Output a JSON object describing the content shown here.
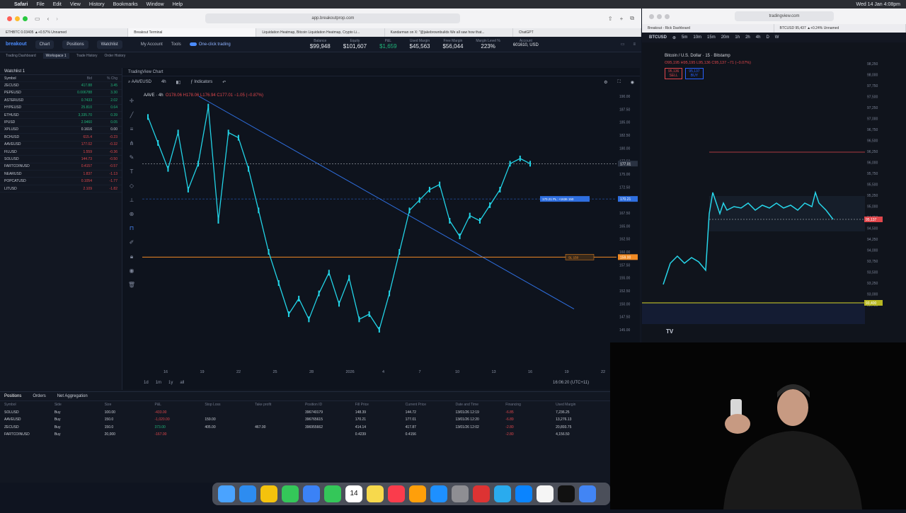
{
  "menubar": {
    "apple": "",
    "items": [
      "Safari",
      "File",
      "Edit",
      "View",
      "History",
      "Bookmarks",
      "Window",
      "Help"
    ],
    "clock": "Wed 14 Jan 4:08pm"
  },
  "left_browser": {
    "url": "app.breakoutprop.com",
    "tabs": [
      "ETHBTC 0.03405 ▲+0.57% Unnamed",
      "Breakout Terminal",
      "Liquidation Heatmap, Bitcoin Liquidation Heatmap, Crypto Li...",
      "Kandarman on X: \"@jakebrownbuilds We all saw how that...",
      "ChatGPT"
    ]
  },
  "app": {
    "logo": "breakout",
    "nav": [
      "Chart",
      "Positions",
      "Watchlist"
    ],
    "account_btn": "My Account",
    "tools_btn": "Tools",
    "one_click": "One-click trading",
    "metrics": [
      {
        "label": "Balance",
        "value": "$99,948"
      },
      {
        "label": "Equity",
        "value": "$101,607"
      },
      {
        "label": "P&L",
        "value": "$1,659"
      },
      {
        "label": "Used Margin",
        "value": "$45,563"
      },
      {
        "label": "Free Margin",
        "value": "$56,044"
      },
      {
        "label": "Margin Level %",
        "value": "223%"
      },
      {
        "label": "Account",
        "value": "601610, USD"
      }
    ],
    "subnav": [
      "Trading Dashboard",
      "Workspace 1",
      "Trade History",
      "Order History"
    ]
  },
  "watchlist": {
    "title": "Watchlist 1",
    "columns": [
      "Symbol",
      "Bid",
      "% Chg"
    ],
    "rows": [
      {
        "sym": "ZECUSD",
        "bid": "417.88",
        "chg": "3.45",
        "dir": "pos"
      },
      {
        "sym": "PEPEUSD",
        "bid": "0.006788",
        "chg": "3.30",
        "dir": "pos"
      },
      {
        "sym": "ASTERUSD",
        "bid": "0.7433",
        "chg": "2.02",
        "dir": "pos"
      },
      {
        "sym": "HYPEUSD",
        "bid": "25.810",
        "chg": "0.64",
        "dir": "pos"
      },
      {
        "sym": "ETHUSD",
        "bid": "3,335.70",
        "chg": "0.39",
        "dir": "pos"
      },
      {
        "sym": "IPUSD",
        "bid": "2.9460",
        "chg": "0.05",
        "dir": "pos"
      },
      {
        "sym": "XPLUSD",
        "bid": "0.1616",
        "chg": "0.00",
        "dir": "neutral"
      },
      {
        "sym": "BCHUSD",
        "bid": "615.4",
        "chg": "-0.23",
        "dir": "neg"
      },
      {
        "sym": "AAVEUSD",
        "bid": "177.02",
        "chg": "-0.32",
        "dir": "neg"
      },
      {
        "sym": "FILUSD",
        "bid": "1.559",
        "chg": "-0.36",
        "dir": "neg"
      },
      {
        "sym": "SOLUSD",
        "bid": "144.73",
        "chg": "-0.50",
        "dir": "neg"
      },
      {
        "sym": "FARTCOINUSD",
        "bid": "0.4157",
        "chg": "-0.57",
        "dir": "neg"
      },
      {
        "sym": "NEARUSD",
        "bid": "1.837",
        "chg": "-1.13",
        "dir": "neg"
      },
      {
        "sym": "POPCATUSD",
        "bid": "0.1054",
        "chg": "-1.77",
        "dir": "neg"
      },
      {
        "sym": "LITUSD",
        "bid": "2.109",
        "chg": "-1.82",
        "dir": "neg"
      }
    ]
  },
  "chart": {
    "panel_title": "TradingView Chart",
    "symbol": "AAVEUSD",
    "timeframe": "4h",
    "indicators_btn": "Indicators",
    "ohlc_prefix": "AAVE · 4h",
    "ohlc": "O178.06 H178.06 L176.94 C177.01 −1.05 (−0.87%)",
    "x_labels": [
      "16",
      "19",
      "22",
      "25",
      "28",
      "2026",
      "4",
      "7",
      "10",
      "13",
      "16",
      "19",
      "22"
    ],
    "y_labels": [
      "190.00",
      "187.50",
      "185.00",
      "182.50",
      "180.00",
      "177.50",
      "175.00",
      "172.50",
      "170.00",
      "167.50",
      "165.00",
      "162.50",
      "160.00",
      "157.50",
      "155.00",
      "152.50",
      "150.00",
      "147.50",
      "145.00"
    ],
    "current_price_tag": "177.01",
    "order_tag": "170.21",
    "order_label": "170.21 PL: +1636 150",
    "sl_label": "SL 150",
    "sl_price_tag": "159.00",
    "time_buttons": [
      "1d",
      "1m",
      "1y",
      "all"
    ],
    "clock": "16:06:20 (UTC+11)"
  },
  "chart_data": {
    "type": "line",
    "title": "AAVEUSD 4h",
    "ylim": [
      145,
      190
    ],
    "series": [
      {
        "name": "AAVEUSD",
        "values": [
          186,
          181,
          176,
          183,
          172,
          177,
          188,
          166,
          183,
          182,
          176,
          168,
          160,
          154,
          148,
          151,
          147,
          152,
          156,
          150,
          155,
          147,
          148,
          145,
          152,
          160,
          168,
          170,
          172,
          173,
          166,
          163,
          167,
          166,
          169,
          172,
          177,
          178,
          177
        ]
      }
    ]
  },
  "positions": {
    "tabs": [
      "Positions",
      "Orders",
      "Net Aggregation"
    ],
    "columns": [
      "Symbol",
      "Side",
      "Size",
      "P&L",
      "Stop Loss",
      "Take profit",
      "Position ID",
      "Fill Price",
      "Current Price",
      "Date and Time",
      "Financing",
      "Used Margin"
    ],
    "rows": [
      [
        "SOLUSD",
        "Buy",
        "100.00",
        "-433.00",
        "",
        "",
        "396740179",
        "148.39",
        "144.72",
        "13/01/26 12:19",
        "-6.85",
        "7,236.25"
      ],
      [
        "AAVEUSD",
        "Buy",
        "150.0",
        "-1,020.00",
        "159.00",
        "",
        "396765615",
        "170.21",
        "177.01",
        "13/01/26 12:20",
        "-6.89",
        "13,276.13"
      ],
      [
        "ZECUSD",
        "Buy",
        "150.0",
        "373.00",
        "405.00",
        "467.00",
        "396955662",
        "414.14",
        "417.87",
        "13/01/26 12:02",
        "-2.80",
        "20,893.75"
      ],
      [
        "FARTCOINUSD",
        "Buy",
        "20,000",
        "-167.00",
        "",
        "",
        "",
        "0.4239",
        "0.4156",
        "",
        "-2.80",
        "4,156.50"
      ]
    ]
  },
  "right_browser": {
    "url": "tradingview.com",
    "tabs": [
      "Breakout - Rick Dashboard",
      "BTCUSD 95,437 ▲+0.24% Unnamed"
    ],
    "symbol": "BTCUSD",
    "timeframes": [
      "5m",
      "10m",
      "15m",
      "20m",
      "1h",
      "2h",
      "4h",
      "D",
      "W"
    ],
    "title": "Bitcoin / U.S. Dollar · 15 · Bitstamp",
    "ohlc": "O95,195 H95,195 L95,136 C95,137 −71 (−0.07%)",
    "sell": "95,136",
    "buy": "95,137",
    "sell_label": "SELL",
    "buy_label": "BUY",
    "y_labels": [
      "98,250",
      "98,000",
      "97,750",
      "97,500",
      "97,250",
      "97,000",
      "96,750",
      "96,500",
      "96,250",
      "96,000",
      "95,750",
      "95,500",
      "95,250",
      "95,000",
      "94,750",
      "94,500",
      "94,250",
      "94,000",
      "93,750",
      "93,500",
      "93,250",
      "93,000",
      "92,750"
    ],
    "price_tag": "95,137",
    "level_tag": "93,400",
    "tv_logo": "TV"
  },
  "dock": {
    "icons": [
      "finder",
      "safari",
      "chrome",
      "messages",
      "mail",
      "facetime",
      "calendar",
      "notes",
      "music",
      "pages",
      "appstore",
      "settings",
      "parallels",
      "telegram",
      "screenflow",
      "textedit",
      "chatgpt",
      "chrome-alt"
    ],
    "calendar_day": "14"
  }
}
